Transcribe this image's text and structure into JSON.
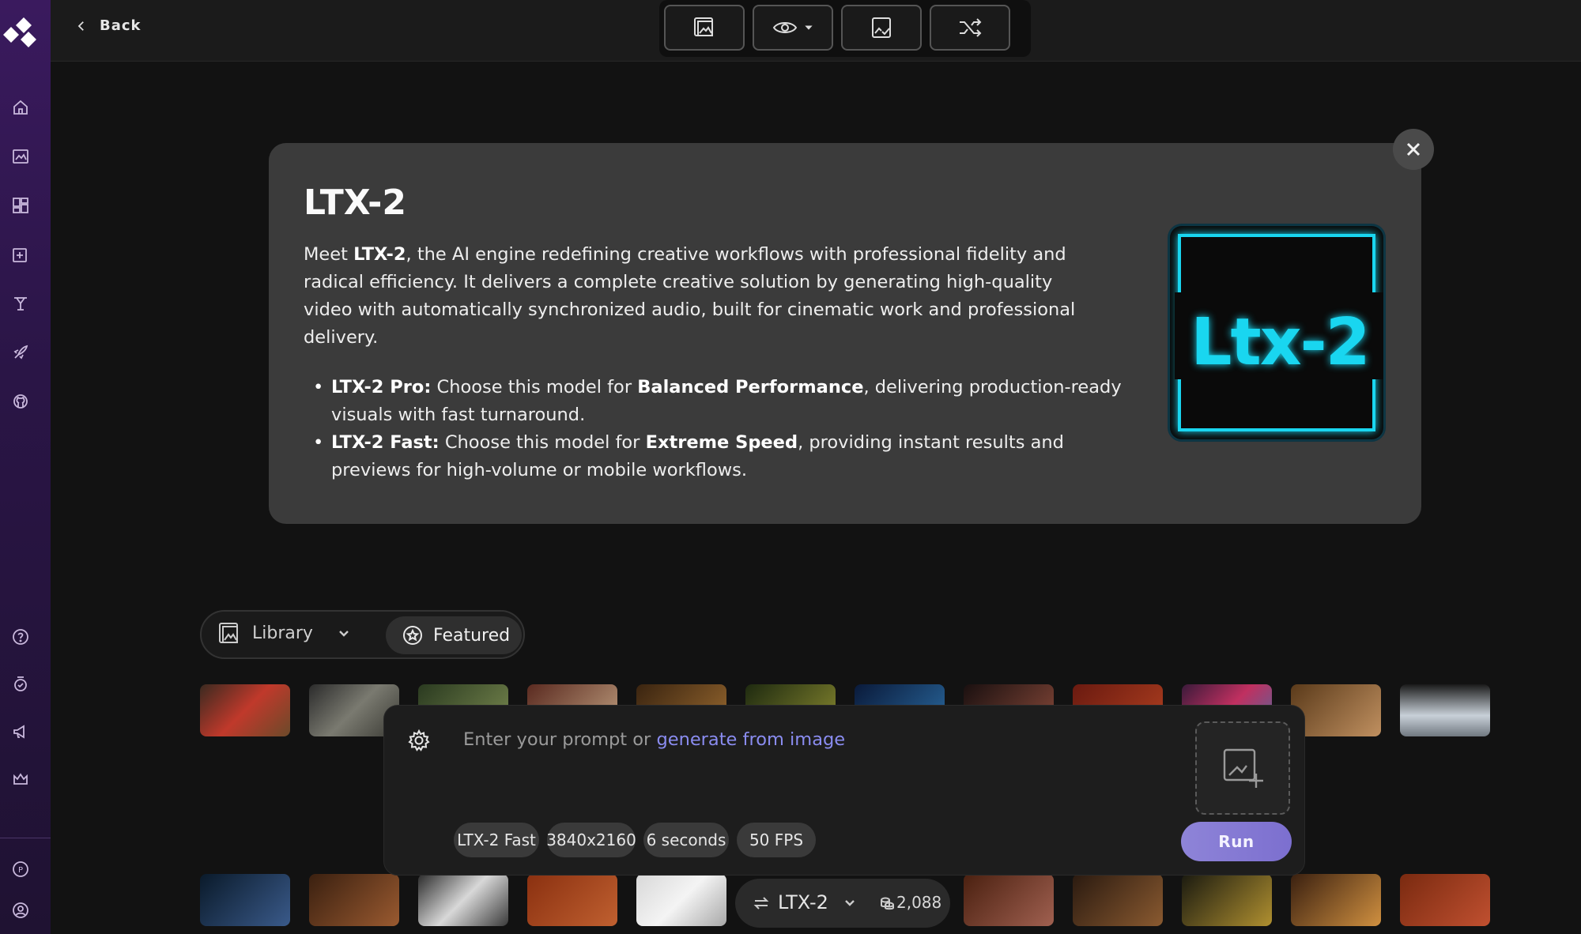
{
  "topbar": {
    "back_label": "Back",
    "tools": [
      {
        "icon": "gallery-icon"
      },
      {
        "icon": "eye-icon"
      },
      {
        "icon": "image-check-icon"
      },
      {
        "icon": "shuffle-icon"
      }
    ]
  },
  "sidebar": {
    "items": [
      {
        "icon": "home-icon"
      },
      {
        "icon": "image-gallery-icon"
      },
      {
        "icon": "dashboard-icon"
      },
      {
        "icon": "image-edit-icon"
      },
      {
        "icon": "trophy-icon"
      },
      {
        "icon": "rocket-icon"
      },
      {
        "icon": "github-icon"
      }
    ],
    "bottom_items": [
      {
        "icon": "help-icon"
      },
      {
        "icon": "badge-icon"
      },
      {
        "icon": "megaphone-icon"
      },
      {
        "icon": "crown-icon"
      },
      {
        "icon": "p-circle-icon",
        "letter": "P"
      },
      {
        "icon": "user-icon"
      }
    ]
  },
  "modal": {
    "title": "LTX-2",
    "desc_meet": "Meet ",
    "desc_name": "LTX-2",
    "desc_rest": ", the AI engine redefining creative workflows with professional fidelity and radical efficiency. It delivers a complete creative solution by generating high-quality video with automatically synchronized audio, built for cinematic work and professional delivery.",
    "items": [
      {
        "name": "LTX-2 Pro:",
        "pre": " Choose this model for ",
        "emph": "Balanced Performance",
        "post": ", delivering production-ready visuals with fast turnaround."
      },
      {
        "name": "LTX-2 Fast:",
        "pre": " Choose this model for ",
        "emph": "Extreme Speed",
        "post": ", providing instant results and previews for high-volume or mobile workflows."
      }
    ],
    "logo_text": "Ltx-2",
    "logo_color": "#19d6f0"
  },
  "gallery_tabs": {
    "library_label": "Library",
    "featured_label": "Featured"
  },
  "prompt": {
    "placeholder_prefix": "Enter your prompt or ",
    "placeholder_link": "generate from image",
    "chips": [
      "LTX-2 Fast",
      "3840x2160",
      "6 seconds",
      "50 FPS"
    ],
    "run_label": "Run"
  },
  "model_selector": {
    "model": "LTX-2",
    "credits": "2,088"
  },
  "colors": {
    "accent": "#7c6fcf",
    "link": "#8a8cf0",
    "sidebar_top": "#3a1a5e"
  }
}
